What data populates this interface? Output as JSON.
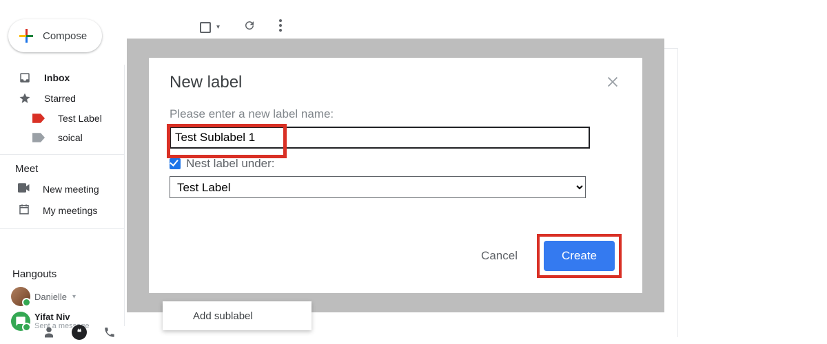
{
  "compose_label": "Compose",
  "sidebar": {
    "inbox": "Inbox",
    "starred": "Starred",
    "test_label": "Test Label",
    "soical": "soical"
  },
  "meet": {
    "header": "Meet",
    "new_meeting": "New meeting",
    "my_meetings": "My meetings"
  },
  "hangouts": {
    "header": "Hangouts",
    "me_name": "Danielle",
    "contact_name": "Yifat Niv",
    "contact_sub": "Sent a message"
  },
  "dialog": {
    "title": "New label",
    "name_prompt": "Please enter a new label name:",
    "name_value": "Test Sublabel 1",
    "nest_label": "Nest label under:",
    "parent_value": "Test Label",
    "cancel": "Cancel",
    "create": "Create"
  },
  "popover": {
    "add_sublabel": "Add sublabel"
  }
}
